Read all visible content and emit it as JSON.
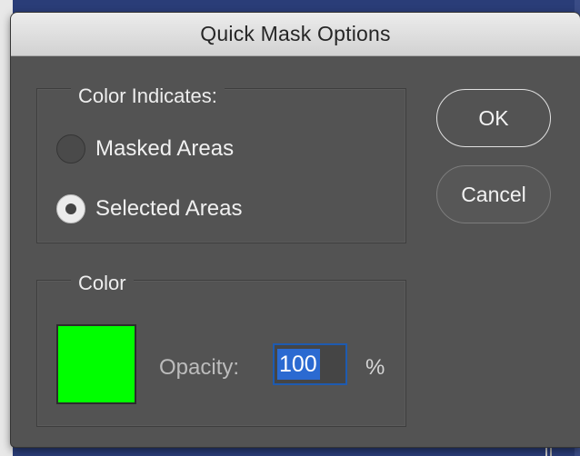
{
  "dialog": {
    "title": "Quick Mask Options"
  },
  "color_indicates": {
    "legend": "Color Indicates:",
    "options": [
      {
        "label": "Masked Areas",
        "selected": false
      },
      {
        "label": "Selected Areas",
        "selected": true
      }
    ]
  },
  "color": {
    "legend": "Color",
    "swatch_color": "#00ff00",
    "opacity_label": "Opacity:",
    "opacity_value": "100",
    "percent_label": "%"
  },
  "buttons": {
    "ok_label": "OK",
    "cancel_label": "Cancel"
  }
}
